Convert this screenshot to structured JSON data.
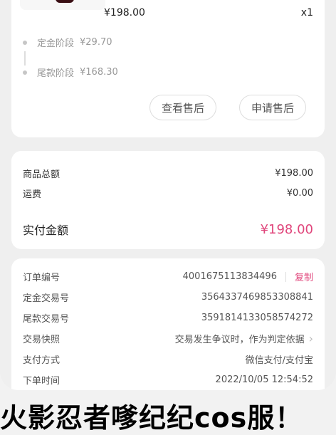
{
  "product": {
    "price": "¥198.00",
    "quantity": "x1",
    "stages": [
      {
        "name": "定金阶段",
        "amount": "¥29.70"
      },
      {
        "name": "尾款阶段",
        "amount": "¥168.30"
      }
    ],
    "buttons": {
      "view_after_sale": "查看售后",
      "apply_after_sale": "申请售后"
    }
  },
  "amounts": {
    "total_label": "商品总额",
    "total_value": "¥198.00",
    "shipping_label": "运费",
    "shipping_value": "¥0.00",
    "paid_label": "实付金额",
    "paid_value": "¥198.00"
  },
  "order_info": {
    "order_no_label": "订单编号",
    "order_no": "4001675113834496",
    "copy_label": "复制",
    "deposit_tx_label": "定金交易号",
    "deposit_tx": "3564337469853308841",
    "final_tx_label": "尾款交易号",
    "final_tx": "3591814133058574272",
    "snapshot_label": "交易快照",
    "snapshot_value": "交易发生争议时，作为判定依据",
    "payment_label": "支付方式",
    "payment_value": "微信支付/支付宝",
    "time_label": "下单时间",
    "time_value": "2022/10/05 12:54:52"
  },
  "caption": "火影忍者嗲纪纪cos服！"
}
